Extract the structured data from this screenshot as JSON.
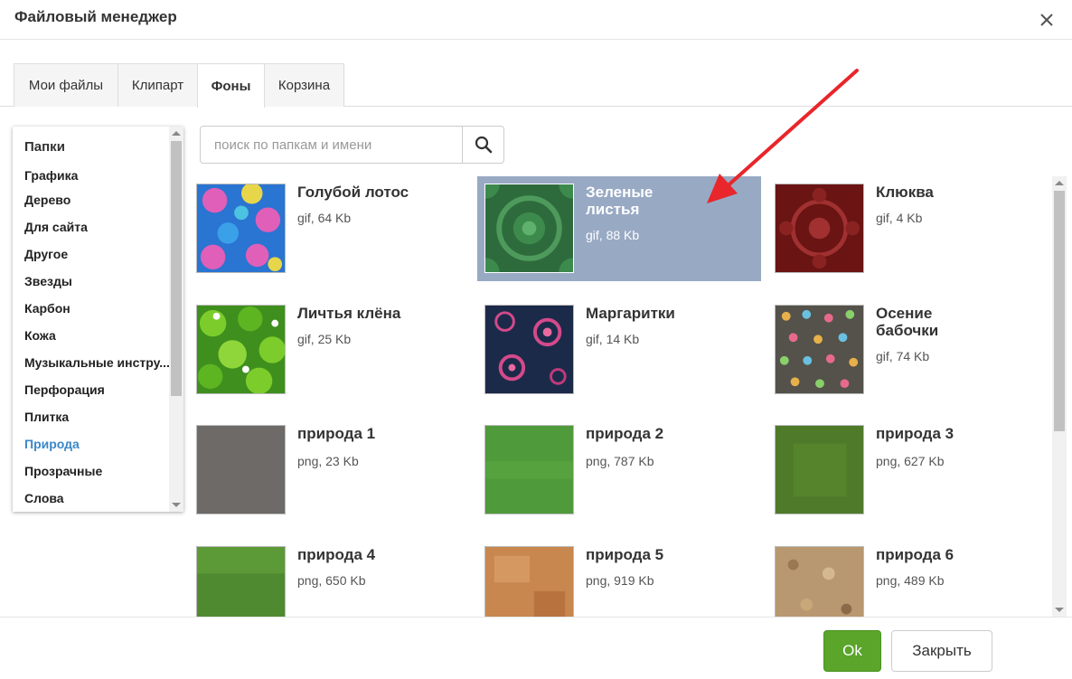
{
  "title": "Файловый менеджер",
  "tabs": [
    {
      "label": "Мои файлы"
    },
    {
      "label": "Клипарт"
    },
    {
      "label": "Фоны"
    },
    {
      "label": "Корзина"
    }
  ],
  "active_tab": "Фоны",
  "folders": {
    "heading": "Папки",
    "items": [
      "Графика",
      "Дерево",
      "Для сайта",
      "Другое",
      "Звезды",
      "Карбон",
      "Кожа",
      "Музыкальные инстру...",
      "Перфорация",
      "Плитка",
      "Природа",
      "Прозрачные",
      "Слова"
    ],
    "active": "Природа"
  },
  "search": {
    "placeholder": "поиск по папкам и имени"
  },
  "files": [
    {
      "name": "Голубой лотос",
      "meta": "gif, 64 Kb"
    },
    {
      "name": "Зеленые листья",
      "meta": "gif, 88 Kb"
    },
    {
      "name": "Клюква",
      "meta": "gif, 4 Kb"
    },
    {
      "name": "Личтья клёна",
      "meta": "gif, 25 Kb"
    },
    {
      "name": "Маргаритки",
      "meta": "gif, 14 Kb"
    },
    {
      "name": "Осение бабочки",
      "meta": "gif, 74 Kb"
    },
    {
      "name": "природа 1",
      "meta": "png, 23 Kb"
    },
    {
      "name": "природа 2",
      "meta": "png, 787 Kb"
    },
    {
      "name": "природа 3",
      "meta": "png, 627 Kb"
    },
    {
      "name": "природа 4",
      "meta": "png, 650 Kb"
    },
    {
      "name": "природа 5",
      "meta": "png, 919 Kb"
    },
    {
      "name": "природа 6",
      "meta": "png, 489 Kb"
    }
  ],
  "selected_file": "Зеленые листья",
  "footer": {
    "ok_label": "Ok",
    "close_label": "Закрыть"
  },
  "colors": {
    "selected": "#98a9c4",
    "ok": "#5aa52a",
    "active_folder": "#3a87c8",
    "annotation_arrow": "#e8262b"
  }
}
